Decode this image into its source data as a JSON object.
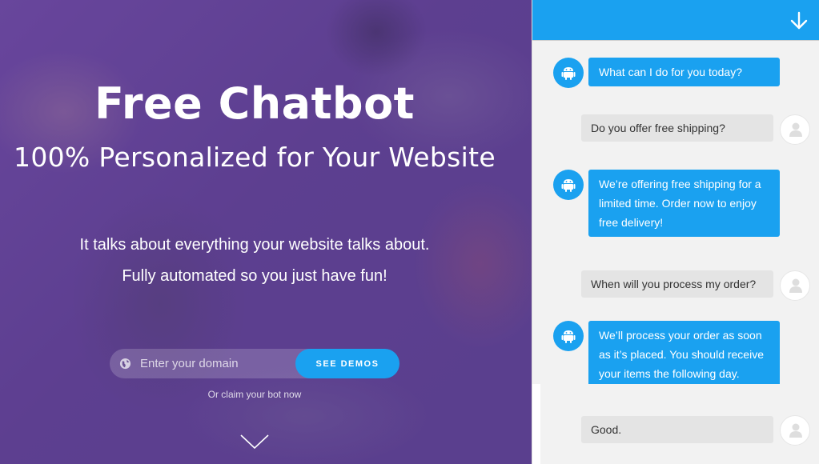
{
  "hero": {
    "title": "Free Chatbot",
    "subtitle": "100% Personalized for Your Website",
    "line1": "It talks about everything your website talks about.",
    "line2": "Fully automated so you just have fun!",
    "domain_placeholder": "Enter your domain",
    "cta_label": "SEE DEMOS",
    "claim_text": "Or claim your bot now",
    "icons": {
      "input": "globe-icon",
      "scroll": "chevron-down-icon"
    }
  },
  "chat": {
    "header_icon": "arrow-down-icon",
    "messages": [
      {
        "from": "bot",
        "text": "What can I do for you today?"
      },
      {
        "from": "user",
        "text": "Do you offer free shipping?"
      },
      {
        "from": "bot",
        "text": "We’re offering free shipping for a limited time. Order now to enjoy free delivery!"
      },
      {
        "from": "user",
        "text": "When will you process my order?"
      },
      {
        "from": "bot",
        "text": "We’ll process your order as soon as it’s placed. You should receive your items the following day."
      },
      {
        "from": "user",
        "text": "Good."
      }
    ],
    "bot_avatar_icon": "android-icon",
    "user_avatar_icon": "user-icon"
  },
  "colors": {
    "accent": "#1aa1f0",
    "hero_overlay": "#603f96",
    "user_bubble": "#e4e4e4",
    "chat_bg": "#f2f2f2"
  }
}
